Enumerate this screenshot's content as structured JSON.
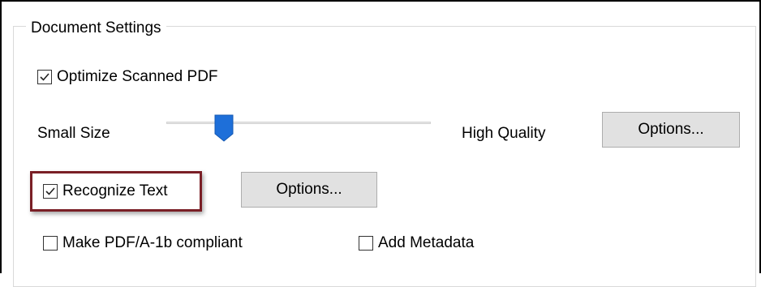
{
  "group": {
    "title": "Document Settings"
  },
  "optimize": {
    "label": "Optimize Scanned PDF",
    "checked": true
  },
  "slider": {
    "left_label": "Small Size",
    "right_label": "High Quality",
    "value_fraction": 0.2
  },
  "options_button_1": {
    "label": "Options..."
  },
  "recognize": {
    "label": "Recognize Text",
    "checked": true
  },
  "options_button_2": {
    "label": "Options..."
  },
  "pdfa": {
    "label": "Make PDF/A-1b compliant",
    "checked": false
  },
  "metadata": {
    "label": "Add Metadata",
    "checked": false
  },
  "colors": {
    "highlight_border": "#7a1f26",
    "slider_thumb": "#1e6fd9"
  }
}
